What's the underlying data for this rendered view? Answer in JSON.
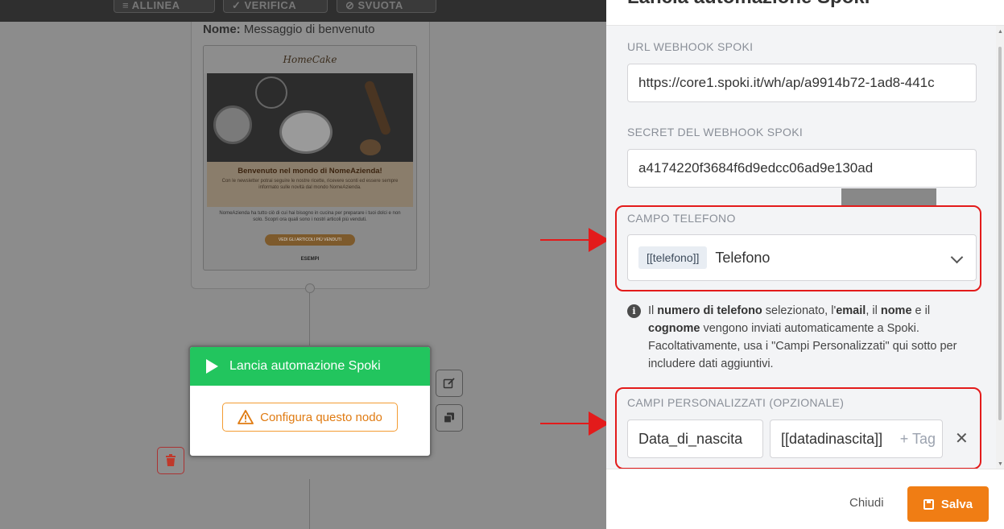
{
  "toolbar": {
    "align_label": "ALLINEA",
    "verify_label": "VERIFICA",
    "clear_label": "SVUOTA"
  },
  "email_node": {
    "name_label": "Nome:",
    "name_value": "Messaggio di benvenuto",
    "preview": {
      "logo_text": "HomeCake",
      "headline": "Benvenuto nel mondo di NomeAzienda!",
      "intro": "Con le newsletter potrai seguire le nostre ricette, ricevere sconti ed essere sempre informato sulle novità dal mondo NomeAzienda.",
      "body": "NomeAzienda ha tutto ciò di cui hai bisogno in cucina per preparare i tuoi dolci e non solo. Scopri ora quali sono i nostri articoli più venduti.",
      "cta": "VEDI GLI ARTICOLI PIÙ VENDUTI",
      "footer": "ESEMPI"
    }
  },
  "spoki_node": {
    "title": "Lancia automazione Spoki",
    "configure_label": "Configura questo nodo"
  },
  "panel": {
    "title": "Lancia automazione Spoki",
    "webhook_url_label": "URL WEBHOOK SPOKI",
    "webhook_url_value": "https://core1.spoki.it/wh/ap/a9914b72-1ad8-441c",
    "secret_label": "SECRET DEL WEBHOOK SPOKI",
    "secret_value": "a4174220f3684f6d9edcc06ad9e130ad",
    "phone_label": "CAMPO TELEFONO",
    "phone_tag": "[[telefono]]",
    "phone_value": "Telefono",
    "info": {
      "p1": "Il ",
      "b1": "numero di telefono",
      "p2": " selezionato, l'",
      "b2": "email",
      "p3": ", il ",
      "b3": "nome",
      "p4": " e il ",
      "b4": "cognome",
      "p5": " vengono inviati automaticamente a Spoki. Facoltativamente, usa i \"Campi Personalizzati\" qui sotto per includere dati aggiuntivi."
    },
    "custom_label": "CAMPI PERSONALIZZATI (OPZIONALE)",
    "custom_name": "Data_di_nascita",
    "custom_value": "[[datadinascita]]",
    "tag_placeholder": "Tag",
    "close_label": "Chiudi",
    "save_label": "Salva"
  },
  "colors": {
    "accent_green": "#22c55e",
    "accent_orange": "#f07d14",
    "highlight_red": "#e31b1b"
  }
}
